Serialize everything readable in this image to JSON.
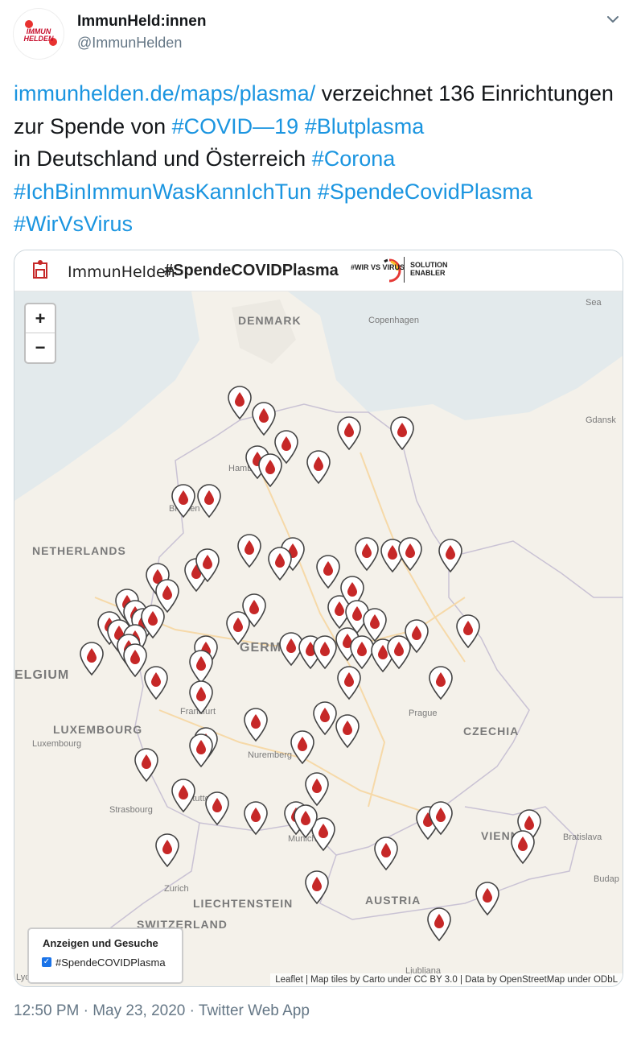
{
  "account": {
    "name": "ImmunHeld:innen",
    "handle": "@ImmunHelden",
    "avatar_text": "IMMUN HELDEN"
  },
  "tweet": {
    "segments": [
      {
        "text": "immunhelden.de/maps/plasma/",
        "link": true
      },
      {
        "text": " verzeichnet 136 Einrichtungen zur Spende von ",
        "link": false
      },
      {
        "text": "#COVID—19",
        "link": true
      },
      {
        "text": " ",
        "link": false
      },
      {
        "text": "#Blutplasma",
        "link": true
      },
      {
        "text": " in Deutschland und Österreich ",
        "link": false
      },
      {
        "text": "#Corona",
        "link": true
      },
      {
        "text": " ",
        "link": false
      },
      {
        "text": "#IchBinImmunWasKannIchTun",
        "link": true
      },
      {
        "text": " ",
        "link": false
      },
      {
        "text": "#SpendeCovidPlasma",
        "link": true
      },
      {
        "text": " ",
        "link": false
      },
      {
        "text": "#WirVsVirus",
        "link": true
      }
    ]
  },
  "map_header": {
    "brand": "ImmunHelden",
    "hashtag": "#SpendeCOVIDPlasma",
    "wirvsvirus": "#WIR VS VIRUS",
    "solution": "SOLUTION ENABLER"
  },
  "map": {
    "zoom_in": "+",
    "zoom_out": "−",
    "labels": {
      "denmark": "DENMARK",
      "copenhagen": "Copenhagen",
      "gdansk": "Gdansk",
      "sea": "Sea",
      "hamburg": "Hamburg",
      "bremen": "Bremen",
      "netherlands": "NETHERLANDS",
      "germany": "GERMANY",
      "belgium": "ELGIUM",
      "frankfurt": "Frankfurt",
      "luxembourg_country": "LUXEMBOURG",
      "luxembourg_city": "Luxembourg",
      "prague": "Prague",
      "czechia": "CZECHIA",
      "nuremberg": "Nuremberg",
      "stuttgart": "Stuttgart",
      "strasbourg": "Strasbourg",
      "munich": "Munich",
      "vienna": "VIENNA",
      "bratislava": "Bratislava",
      "zurich": "Zurich",
      "liechtenstein": "LIECHTENSTEIN",
      "austria": "AUSTRIA",
      "switzerland": "SWITZERLAND",
      "budapest": "Budap",
      "ljubljana": "Ljubljana",
      "lyon": "Lyon"
    },
    "marker_color": "#c62828",
    "legend": {
      "title": "Anzeigen und Gesuche",
      "item": "#SpendeCOVIDPlasma",
      "checked": true
    },
    "attribution": "Leaflet | Map tiles by Carto under CC BY 3.0 | Data by OpenStreetMap under ODbL"
  },
  "footer": {
    "time": "12:50 PM",
    "date": "May 23, 2020",
    "app": "Twitter Web App",
    "separator": "·"
  }
}
